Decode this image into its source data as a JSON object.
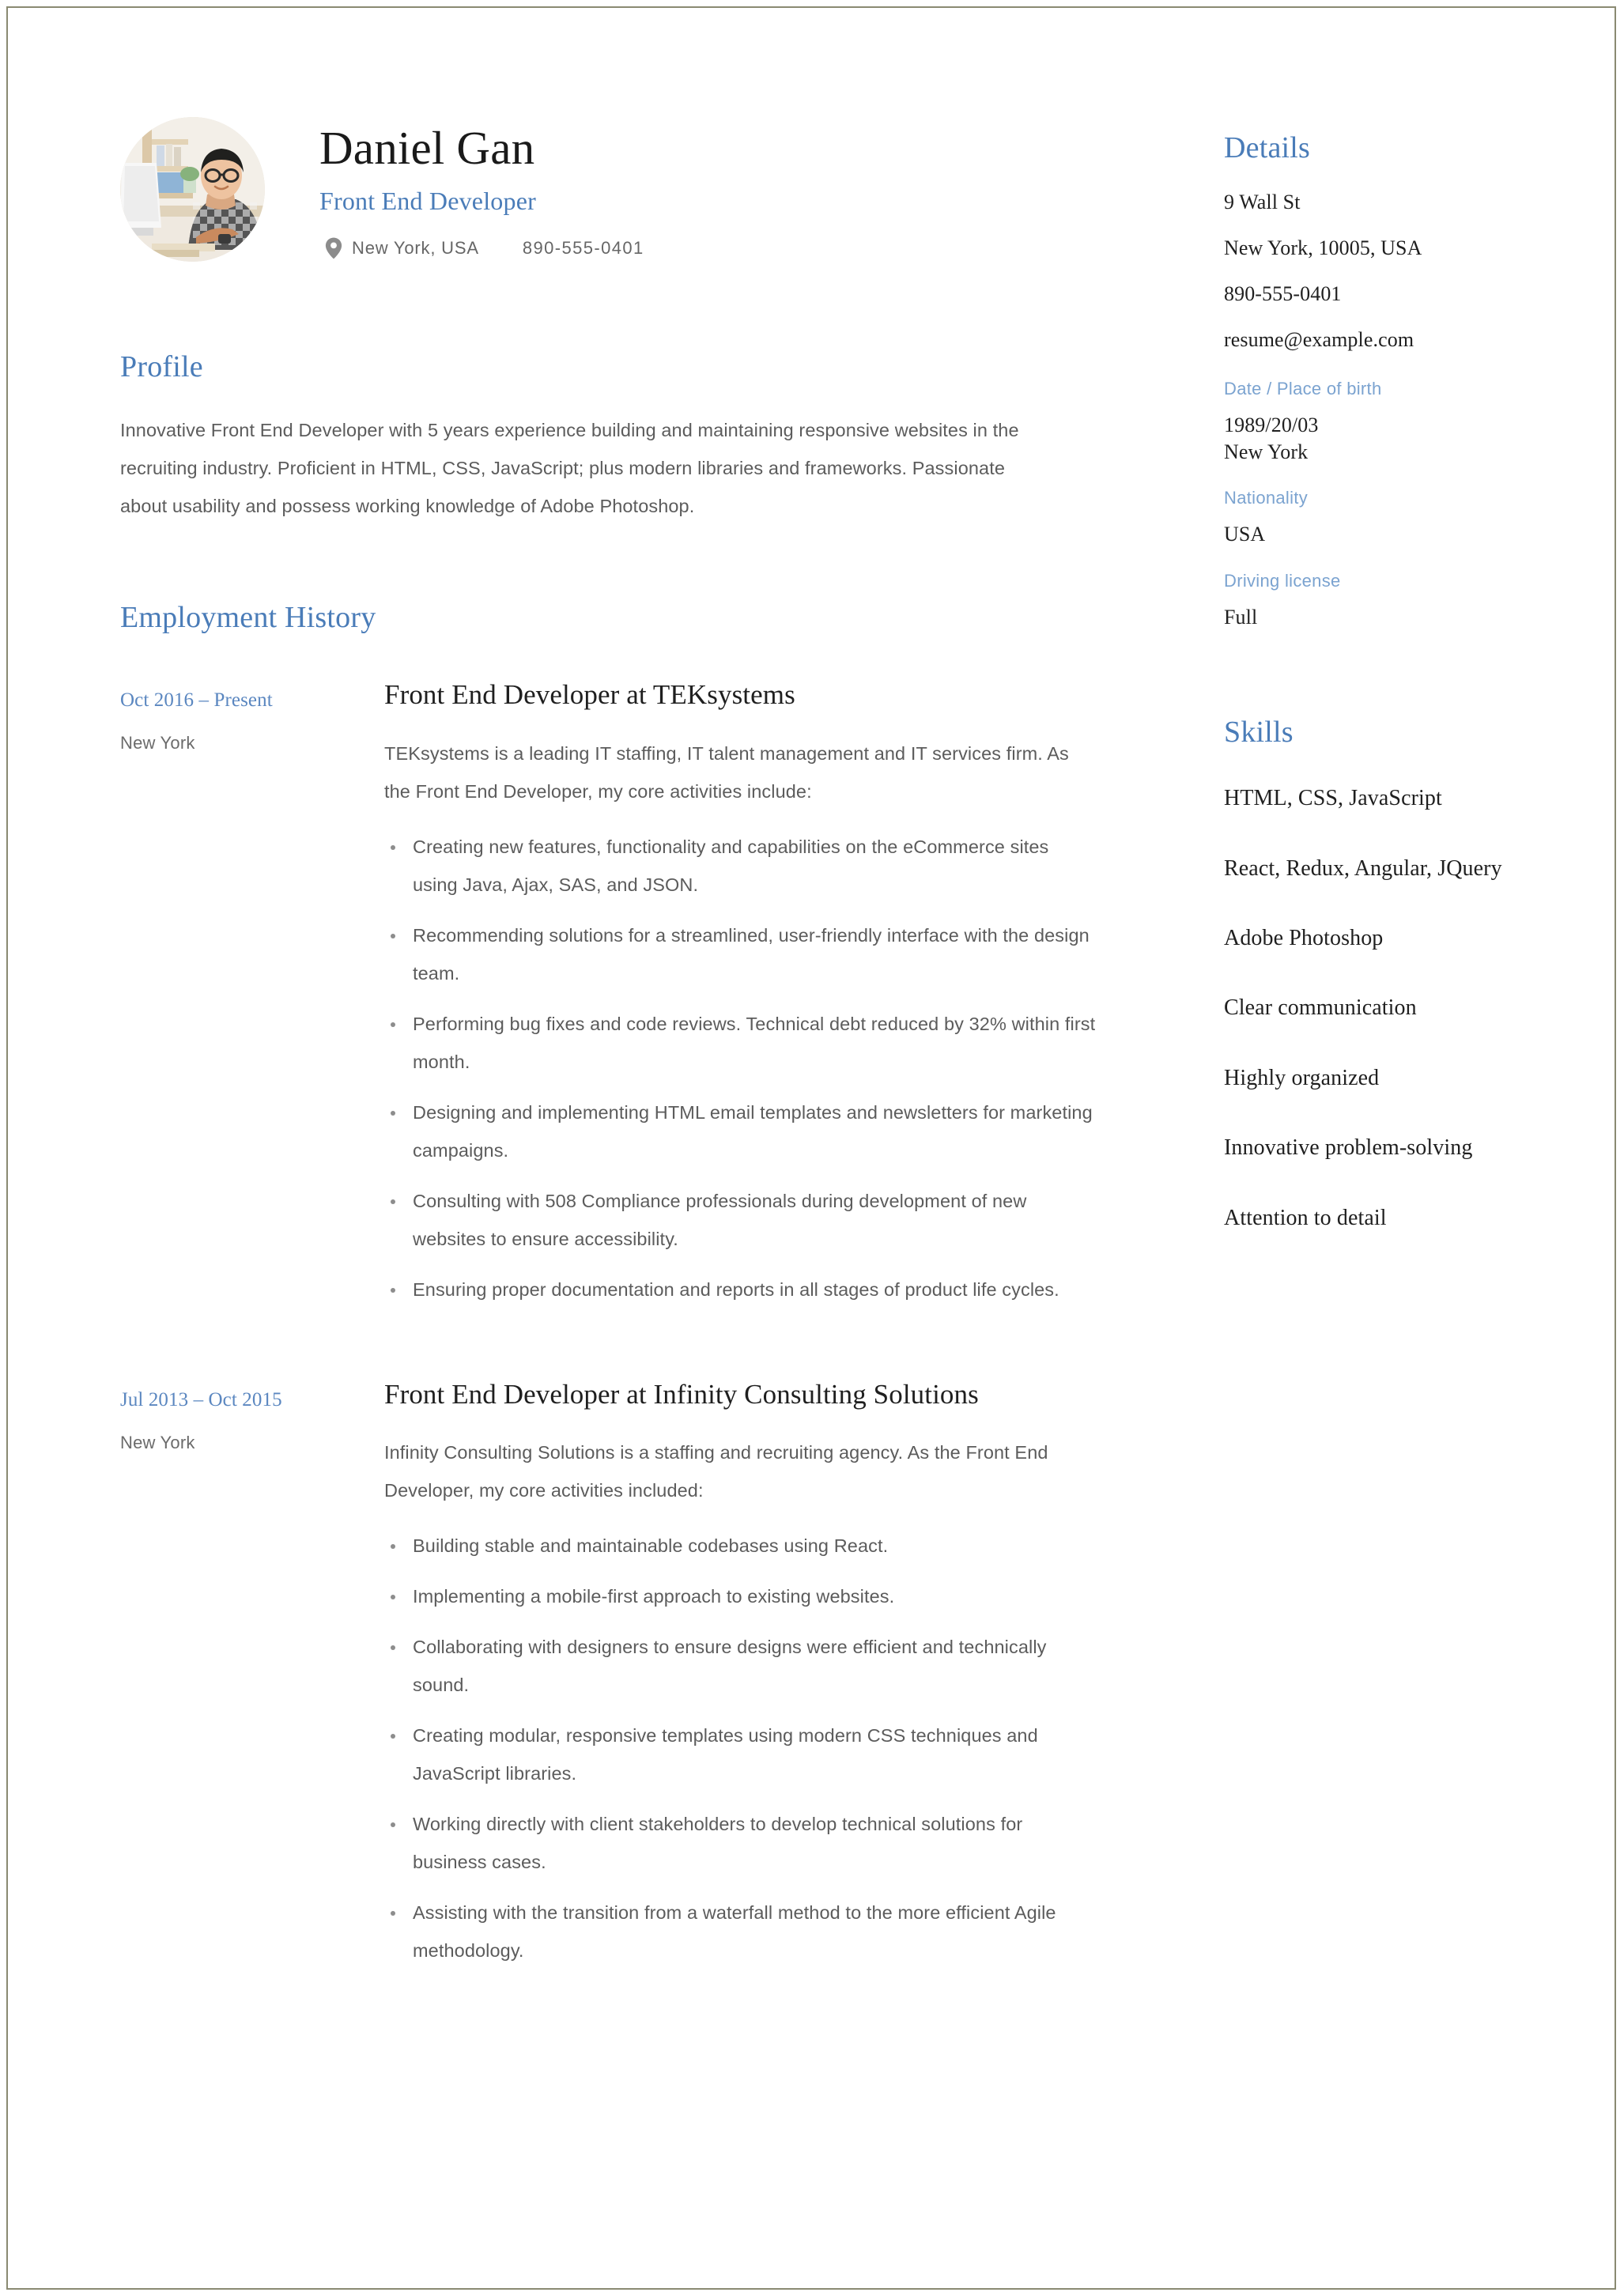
{
  "theme": {
    "accent_blue": "#4a7cb8",
    "label_blue": "#7ba3d0",
    "body_grey": "#5c5c5c",
    "heading_dark": "#1f1f1f",
    "page_border": "#8a8a72"
  },
  "header": {
    "name": "Daniel Gan",
    "job_title": "Front End Developer",
    "location_icon": "map-pin-icon",
    "location": "New York, USA",
    "phone": "890-555-0401",
    "photo_alt": "Portrait of a man with glasses in a checkered shirt seated at a desk"
  },
  "profile": {
    "heading": "Profile",
    "text": "Innovative Front End Developer with 5 years experience building and maintaining responsive websites in the recruiting industry. Proficient in HTML, CSS, JavaScript; plus modern libraries and frameworks. Passionate about usability and possess working knowledge of Adobe Photoshop."
  },
  "employment": {
    "heading": "Employment History",
    "jobs": [
      {
        "date": "Oct 2016 – Present",
        "location": "New York",
        "role": "Front End Developer at TEKsystems",
        "description": "TEKsystems is a leading IT staffing, IT talent management and IT services firm. As the Front End Developer, my core activities include:",
        "bullets": [
          "Creating new features, functionality and capabilities on the eCommerce sites using Java, Ajax, SAS, and JSON.",
          "Recommending solutions for a streamlined, user-friendly interface with the design team.",
          "Performing bug fixes and code reviews. Technical debt reduced by 32% within first month.",
          "Designing and implementing HTML email templates and newsletters for marketing campaigns.",
          "Consulting with 508 Compliance professionals during development of new websites to ensure accessibility.",
          "Ensuring proper documentation and reports in all stages of product life cycles."
        ]
      },
      {
        "date": "Jul 2013 – Oct 2015",
        "location": "New York",
        "role": "Front End Developer at Infinity Consulting Solutions",
        "description": "Infinity Consulting Solutions is a staffing and recruiting agency. As the Front End Developer, my core activities included:",
        "bullets": [
          "Building stable and maintainable codebases using React.",
          "Implementing a mobile-first approach to existing websites.",
          "Collaborating with designers to ensure designs were efficient and technically sound.",
          "Creating modular, responsive templates using modern CSS techniques and JavaScript libraries.",
          "Working directly with client stakeholders to develop technical solutions for business cases.",
          "Assisting with the transition from a waterfall method to the more efficient Agile methodology."
        ]
      }
    ]
  },
  "details": {
    "heading": "Details",
    "address_line1": "9 Wall St",
    "address_line2": "New York, 10005, USA",
    "phone": "890-555-0401",
    "email": "resume@example.com",
    "dob_label": "Date / Place of birth",
    "dob_date": "1989/20/03",
    "dob_place": "New York",
    "nationality_label": "Nationality",
    "nationality_value": "USA",
    "license_label": "Driving license",
    "license_value": "Full"
  },
  "skills": {
    "heading": "Skills",
    "items": [
      "HTML, CSS, JavaScript",
      "React, Redux, Angular, JQuery",
      "Adobe Photoshop",
      "Clear communication",
      "Highly organized",
      "Innovative problem-solving",
      "Attention to detail"
    ]
  }
}
